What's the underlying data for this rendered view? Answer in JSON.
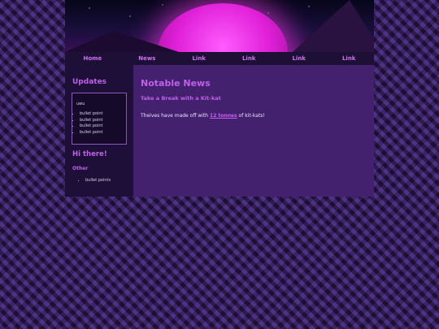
{
  "nav": {
    "items": [
      "Home",
      "News",
      "Link",
      "Link",
      "Link",
      "Link"
    ]
  },
  "sidebar": {
    "updates_title": "Updates",
    "box_text": "uwu",
    "box_bullets": [
      "bullet point",
      "bullet point",
      "bullet point",
      "bullet point"
    ],
    "hi_title": "Hi there!",
    "other_title": "Other",
    "other_bullets": [
      "bullet points"
    ]
  },
  "main": {
    "title": "Notable News",
    "subtitle": "Take a Break with a Kit-kat",
    "text_before": "Theives have made off with ",
    "link_text": "12 tonnes",
    "text_after": " of kit-kats!"
  },
  "colors": {
    "accent": "#c060ea",
    "main_bg": "#44216f",
    "sidebar_bg": "#1e0f38",
    "nav_bg": "#1d0f35"
  }
}
